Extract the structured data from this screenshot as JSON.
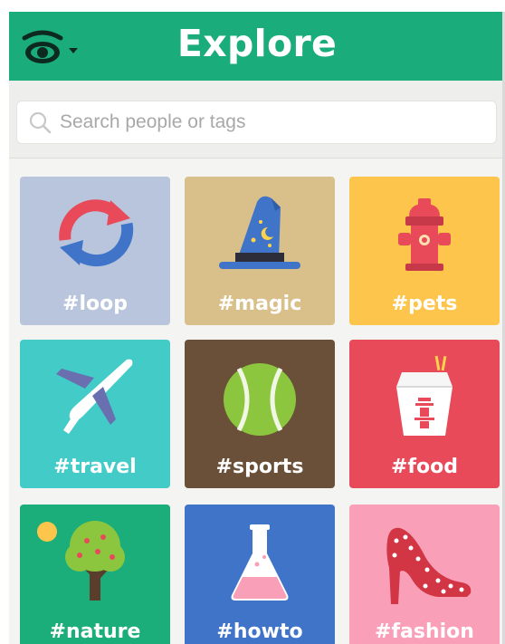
{
  "header": {
    "title": "Explore",
    "menu_icon": "eye-icon",
    "menu_caret": "caret-down-icon",
    "background": "#1bac7b"
  },
  "search": {
    "placeholder": "Search people or tags",
    "icon": "search-icon"
  },
  "tags": [
    {
      "label": "#loop",
      "icon": "loop-arrows-icon",
      "color": "#b9c5dc"
    },
    {
      "label": "#magic",
      "icon": "wizard-hat-icon",
      "color": "#d9bf8a"
    },
    {
      "label": "#pets",
      "icon": "fire-hydrant-icon",
      "color": "#fdc54b"
    },
    {
      "label": "#travel",
      "icon": "airplane-icon",
      "color": "#43cbc8"
    },
    {
      "label": "#sports",
      "icon": "tennis-ball-icon",
      "color": "#6a5038"
    },
    {
      "label": "#food",
      "icon": "takeout-box-icon",
      "color": "#e84a5a"
    },
    {
      "label": "#nature",
      "icon": "tree-icon",
      "color": "#1cae7a"
    },
    {
      "label": "#howto",
      "icon": "flask-icon",
      "color": "#3f74c9"
    },
    {
      "label": "#fashion",
      "icon": "high-heel-icon",
      "color": "#f99fb8"
    }
  ]
}
